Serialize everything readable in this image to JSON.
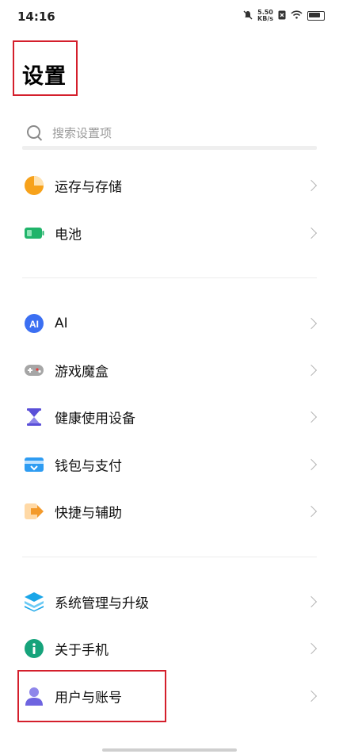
{
  "status_bar": {
    "time": "14:16",
    "net_speed_value": "5.50",
    "net_speed_unit": "KB/s"
  },
  "page": {
    "title": "设置"
  },
  "search": {
    "placeholder": "搜索设置项"
  },
  "groups": [
    {
      "items": [
        {
          "label": "运存与存储",
          "icon": "storage-pie-icon",
          "color": "#f7a21b"
        },
        {
          "label": "电池",
          "icon": "battery-icon",
          "color": "#20b46a"
        }
      ]
    },
    {
      "items": [
        {
          "label": "AI",
          "icon": "ai-icon",
          "color": "#3b6ff2"
        },
        {
          "label": "游戏魔盒",
          "icon": "gamepad-icon",
          "color": "#9a9a9a"
        },
        {
          "label": "健康使用设备",
          "icon": "hourglass-icon",
          "color": "#5a4fd8"
        },
        {
          "label": "钱包与支付",
          "icon": "wallet-icon",
          "color": "#2e9cf2"
        },
        {
          "label": "快捷与辅助",
          "icon": "shortcut-arrow-icon",
          "color": "#f39a2b"
        }
      ]
    },
    {
      "items": [
        {
          "label": "系统管理与升级",
          "icon": "system-layers-icon",
          "color": "#1aa6e8"
        },
        {
          "label": "关于手机",
          "icon": "info-icon",
          "color": "#16a37b"
        },
        {
          "label": "用户与账号",
          "icon": "user-icon",
          "color": "#6e64e0"
        }
      ]
    }
  ]
}
